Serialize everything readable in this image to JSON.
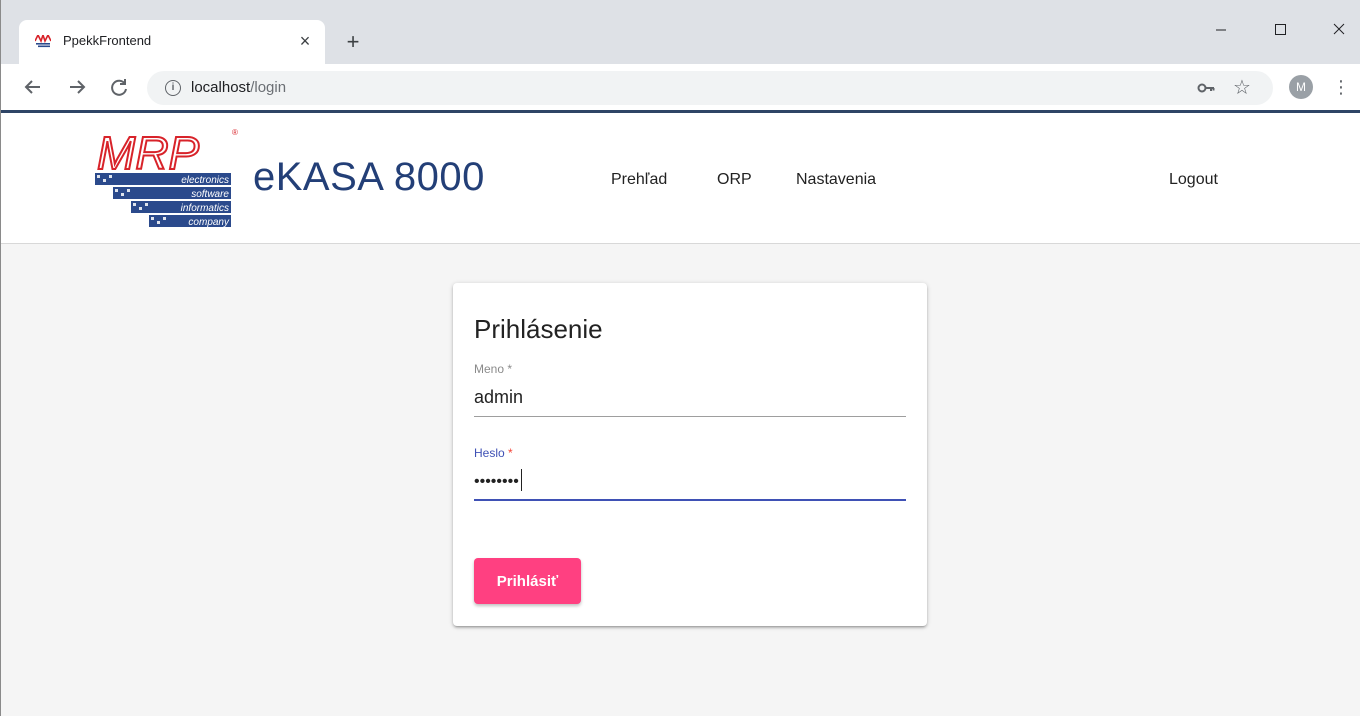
{
  "browser": {
    "tab_title": "PpekkFrontend",
    "tab_close": "×",
    "new_tab": "+",
    "url_host": "localhost",
    "url_path": "/login",
    "info_icon": "i",
    "avatar_initial": "M"
  },
  "header": {
    "logo_text": "MRP",
    "logo_lines": [
      "electronics",
      "software",
      "informatics",
      "company"
    ],
    "brand": "eKASA 8000",
    "nav": {
      "prehlad": "Prehľad",
      "orp": "ORP",
      "nastavenia": "Nastavenia",
      "logout": "Logout"
    }
  },
  "login": {
    "title": "Prihlásenie",
    "username_label": "Meno",
    "username_value": "admin",
    "password_label": "Heslo",
    "password_value": "••••••••",
    "required_mark": " *",
    "submit_label": "Prihlásiť"
  },
  "colors": {
    "brand": "#233f77",
    "accent_pink": "#ff4081",
    "focus_indigo": "#3f51b5",
    "logo_red": "#d8232a",
    "logo_blue": "#2b4a8c"
  },
  "icons": {
    "back": "arrow-left-icon",
    "forward": "arrow-right-icon",
    "reload": "reload-icon",
    "info": "info-icon",
    "key": "key-icon",
    "star": "star-icon",
    "menu": "more-vert-icon",
    "minimize": "minimize-icon",
    "maximize": "maximize-icon",
    "close": "close-icon"
  }
}
